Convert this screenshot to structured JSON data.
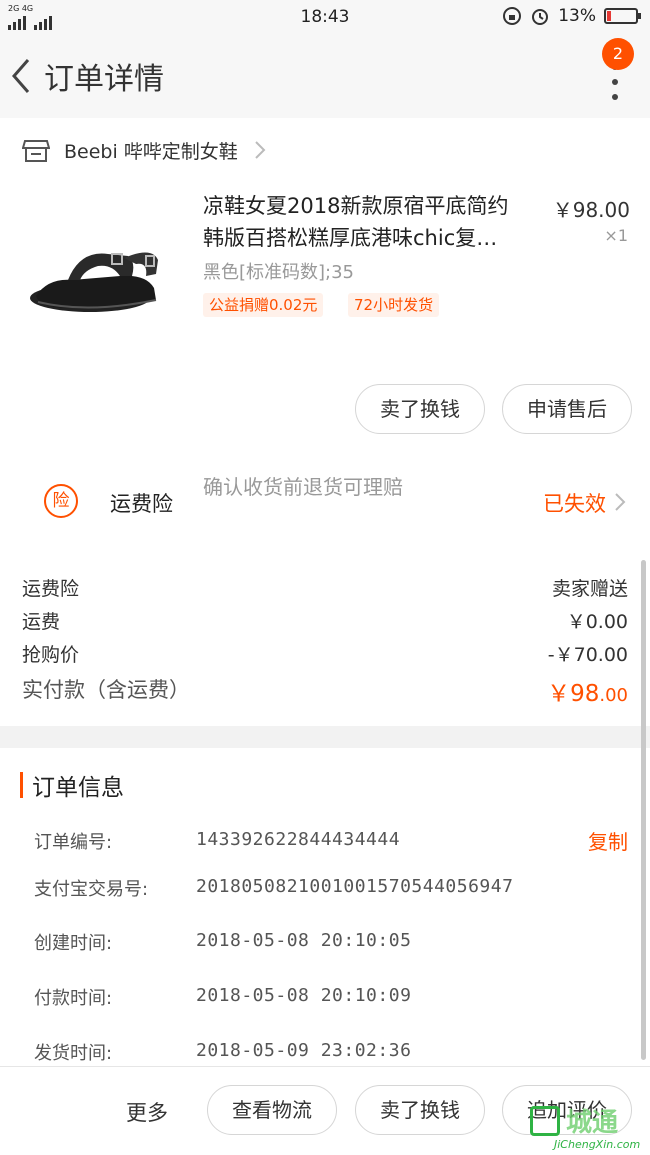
{
  "status_bar": {
    "network": "2G 4G",
    "time": "18:43",
    "battery_pct": "13%"
  },
  "header": {
    "title": "订单详情",
    "notification_count": "2"
  },
  "shop": {
    "name": "Beebi 哔哔定制女鞋"
  },
  "product": {
    "title_line1": "凉鞋女夏2018新款原宿平底简约",
    "title_line2": "韩版百搭松糕厚底港味chic复…",
    "price": "￥98.00",
    "quantity": "×1",
    "sku": "黑色[标准码数];35",
    "tags": [
      "公益捐赠0.02元",
      "72小时发货"
    ]
  },
  "item_actions": {
    "sell_label": "卖了换钱",
    "after_sale_label": "申请售后"
  },
  "insurance": {
    "label": "运费险",
    "description": "确认收货前退货可理赔",
    "status": "已失效"
  },
  "fees": {
    "rows": [
      {
        "label": "运费险",
        "value": "卖家赠送"
      },
      {
        "label": "运费",
        "value": "￥0.00"
      },
      {
        "label": "抢购价",
        "value": "-￥70.00"
      }
    ],
    "total_label": "实付款（含运费）",
    "total_main": "￥98",
    "total_cents": ".00"
  },
  "order_info": {
    "title": "订单信息",
    "copy_label": "复制",
    "rows": [
      {
        "label": "订单编号:",
        "value": "143392622844434444"
      },
      {
        "label": "支付宝交易号:",
        "value": "2018050821001001570544056947"
      },
      {
        "label": "创建时间:",
        "value": "2018-05-08 20:10:05"
      },
      {
        "label": "付款时间:",
        "value": "2018-05-08 20:10:09"
      },
      {
        "label": "发货时间:",
        "value": "2018-05-09 23:02:36"
      }
    ]
  },
  "bottom_bar": {
    "more": "更多",
    "logistics": "查看物流",
    "sell": "卖了换钱",
    "review": "追加评价"
  },
  "watermark": {
    "text": "城通",
    "sub": "JiChengXin.com"
  },
  "colors": {
    "accent": "#ff5000",
    "text": "#333333",
    "muted": "#999999"
  }
}
